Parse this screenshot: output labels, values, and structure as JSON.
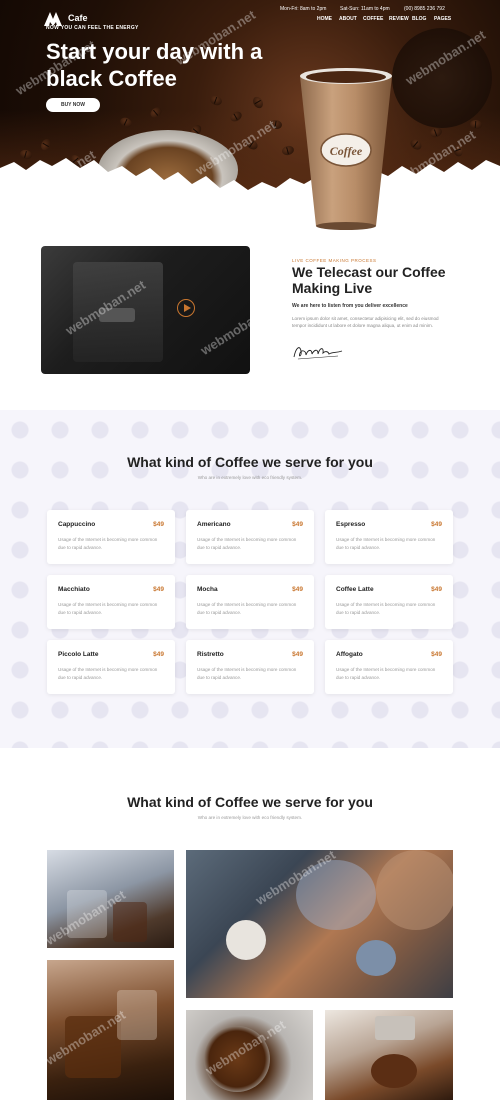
{
  "brand": {
    "name": "Cafe",
    "tagline": "NOW YOU CAN FEEL THE ENERGY"
  },
  "topbar": {
    "hours_weekday": "Mon-Fri: 8am to 2pm",
    "hours_weekend": "Sat-Sun: 11am to 4pm",
    "phone": "(00) 8985 236 792"
  },
  "nav": {
    "items": [
      "HOME",
      "ABOUT",
      "COFFEE",
      "REVIEW",
      "BLOG",
      "PAGES"
    ]
  },
  "hero": {
    "title": "Start your day with a black Coffee",
    "cta": "BUY NOW",
    "cup_label": "Coffee"
  },
  "live": {
    "subtitle": "LIVE COFFEE MAKING PROCESS",
    "title": "We Telecast our Coffee Making Live",
    "lead": "We are here to listen from you deliver excellence",
    "body": "Lorem ipsum dolor sit amet, consectetur adipisicing elit, sed do eiusmod tempor incididunt ut labore et dolore magna aliqua, ut enim ad minim."
  },
  "menu": {
    "title": "What kind of Coffee we serve for you",
    "subtitle": "Who are in extremely love with eco friendly system.",
    "items": [
      {
        "name": "Cappuccino",
        "price": "$49",
        "desc": "Usage of the Internet is becoming more common due to rapid advance."
      },
      {
        "name": "Americano",
        "price": "$49",
        "desc": "Usage of the Internet is becoming more common due to rapid advance."
      },
      {
        "name": "Espresso",
        "price": "$49",
        "desc": "Usage of the Internet is becoming more common due to rapid advance."
      },
      {
        "name": "Macchiato",
        "price": "$49",
        "desc": "Usage of the Internet is becoming more common due to rapid advance."
      },
      {
        "name": "Mocha",
        "price": "$49",
        "desc": "Usage of the Internet is becoming more common due to rapid advance."
      },
      {
        "name": "Coffee Latte",
        "price": "$49",
        "desc": "Usage of the Internet is becoming more common due to rapid advance."
      },
      {
        "name": "Piccolo Latte",
        "price": "$49",
        "desc": "Usage of the Internet is becoming more common due to rapid advance."
      },
      {
        "name": "Ristretto",
        "price": "$49",
        "desc": "Usage of the Internet is becoming more common due to rapid advance."
      },
      {
        "name": "Affogato",
        "price": "$49",
        "desc": "Usage of the Internet is becoming more common due to rapid advance."
      }
    ]
  },
  "gallery": {
    "title": "What kind of Coffee we serve for you",
    "subtitle": "Who are in extremely love with eco friendly system."
  },
  "watermark": "webmoban.net",
  "colors": {
    "accent": "#c8762f",
    "hero_dark": "#1f0f06",
    "section_bg": "#f6f5fb"
  }
}
